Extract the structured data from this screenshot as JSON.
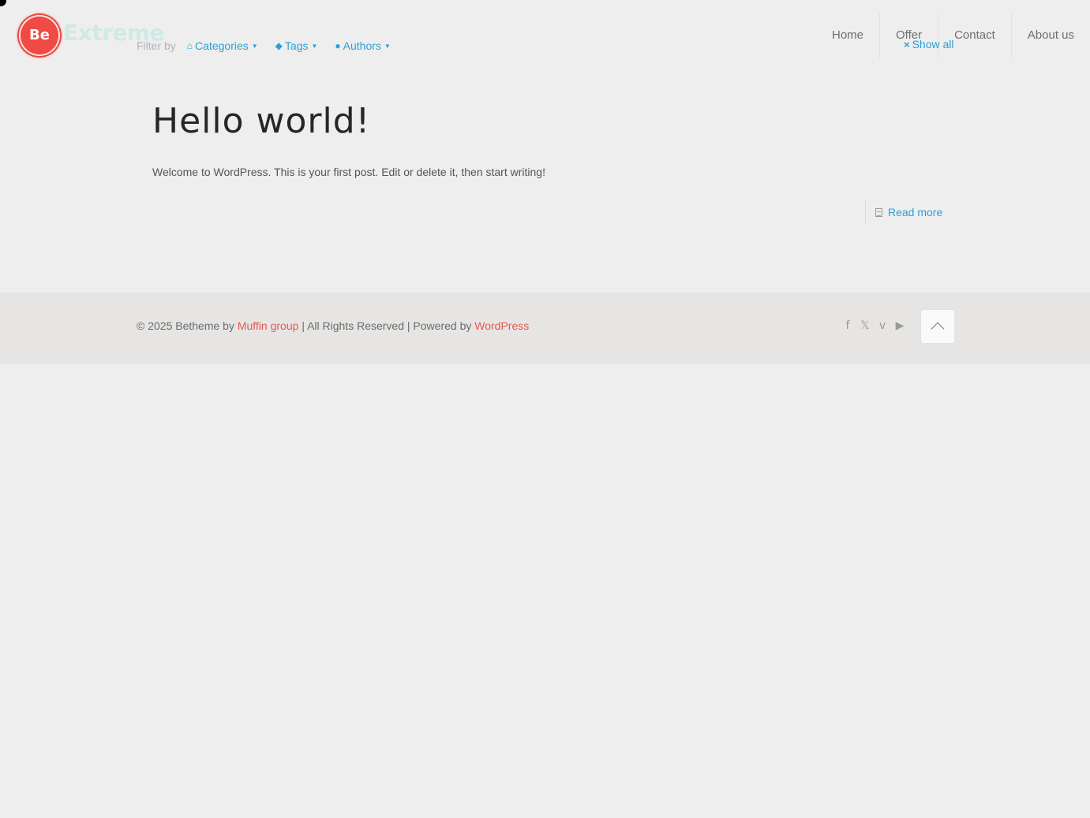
{
  "header": {
    "logo_badge": "Be",
    "logo_text": "Extreme",
    "nav": [
      {
        "label": "Home"
      },
      {
        "label": "Offer"
      },
      {
        "label": "Contact"
      },
      {
        "label": "About us"
      }
    ]
  },
  "filter": {
    "label": "Filter by",
    "items": [
      {
        "label": "Categories",
        "icon": "categories-icon"
      },
      {
        "label": "Tags",
        "icon": "tag-icon"
      },
      {
        "label": "Authors",
        "icon": "user-icon"
      }
    ],
    "show_all": "Show all"
  },
  "post": {
    "title": "Hello world!",
    "excerpt": "Welcome to WordPress. This is your first post. Edit or delete it, then start writing!",
    "read_more": "Read more"
  },
  "footer": {
    "copyright_prefix": "© 2025 Betheme by",
    "author_link": "Muffin group",
    "middle_text": "| All Rights Reserved | Powered by",
    "platform_link": "WordPress",
    "social": [
      "facebook-icon",
      "x-icon",
      "vimeo-icon",
      "youtube-icon"
    ]
  },
  "colors": {
    "background": "#eeeeee",
    "link_blue": "#2a9fd8",
    "link_red": "#e8574f",
    "footer_bg": "#e6e5e4"
  }
}
